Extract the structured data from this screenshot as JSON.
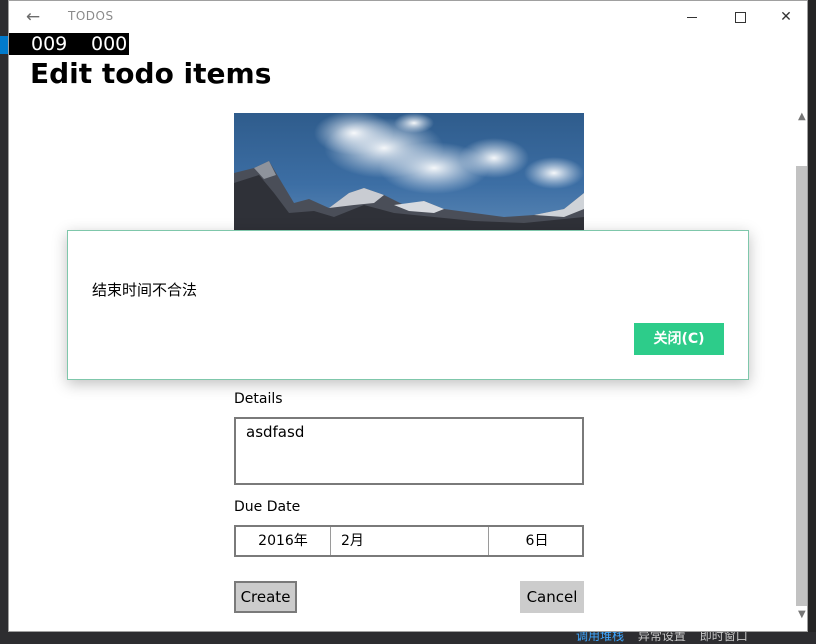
{
  "ide": {
    "bottom_items": [
      "调用堆栈",
      "异常设置",
      "即时窗口"
    ]
  },
  "app": {
    "title": "TODOS",
    "back_icon": "arrow-left-icon"
  },
  "frame_counter": {
    "left": "009",
    "right": "000"
  },
  "page": {
    "title": "Edit todo items"
  },
  "form": {
    "details_label": "Details",
    "details_value": "asdfasd",
    "due_date_label": "Due Date",
    "date": {
      "year": "2016年",
      "month": "2月",
      "day": "6日"
    },
    "create_label": "Create",
    "cancel_label": "Cancel"
  },
  "dialog": {
    "message": "结束时间不合法",
    "close_label": "关闭(C)",
    "accent_color": "#2dcc8a"
  }
}
